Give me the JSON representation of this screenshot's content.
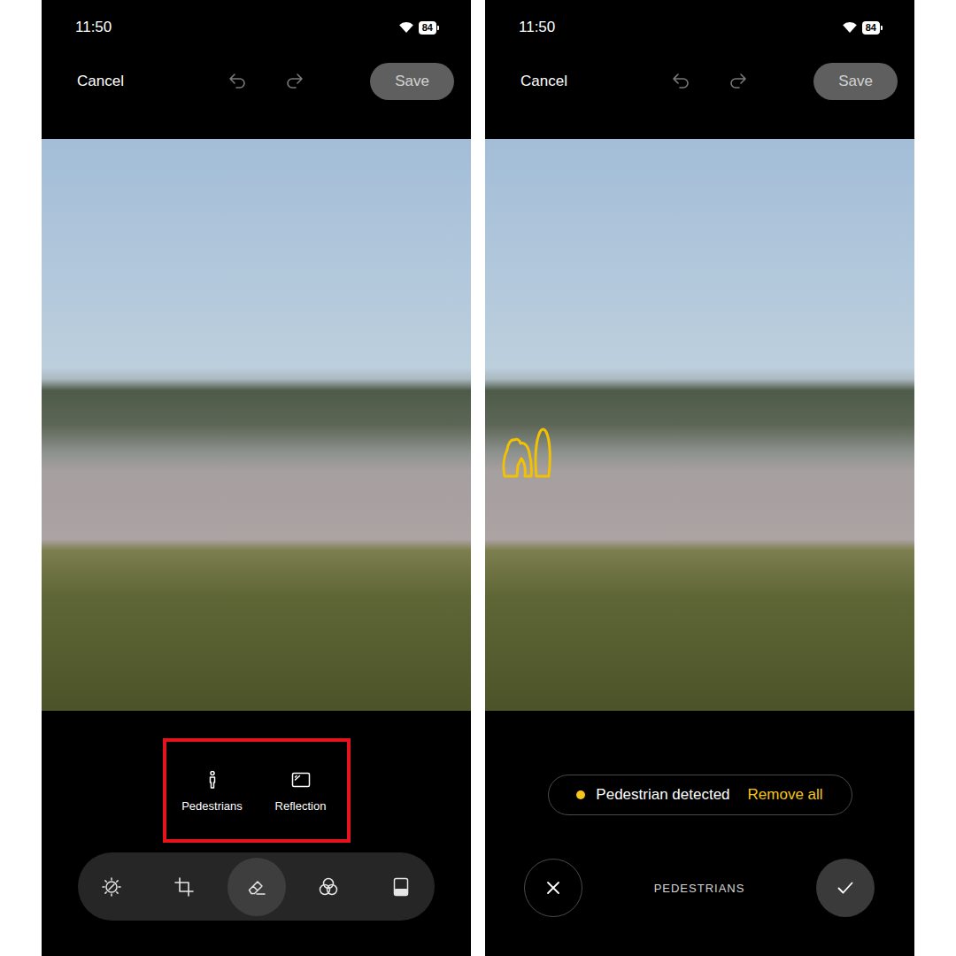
{
  "screens": [
    {
      "kind": "tools",
      "status_bar": {
        "time": "11:50",
        "battery": "84"
      },
      "top_bar": {
        "cancel": "Cancel",
        "undo_enabled": false,
        "redo_enabled": false,
        "save": {
          "label": "Save",
          "disabled": true
        }
      },
      "photo": {
        "highlights": []
      },
      "tool_options": {
        "outlined": true,
        "items": [
          {
            "kind": "pedestrian",
            "label": "Pedestrians"
          },
          {
            "kind": "reflection",
            "label": "Reflection"
          }
        ]
      },
      "toolbar": [
        {
          "kind": "adjust",
          "selected": false
        },
        {
          "kind": "crop",
          "selected": false
        },
        {
          "kind": "erase",
          "selected": true
        },
        {
          "kind": "filters",
          "selected": false
        },
        {
          "kind": "frame",
          "selected": false
        }
      ]
    },
    {
      "kind": "detection",
      "status_bar": {
        "time": "11:50",
        "battery": "84"
      },
      "top_bar": {
        "cancel": "Cancel",
        "undo_enabled": false,
        "redo_enabled": false,
        "save": {
          "label": "Save",
          "disabled": true
        }
      },
      "photo": {
        "highlights": [
          {
            "kind": "pair"
          },
          {
            "kind": "single"
          }
        ]
      },
      "detection": {
        "status": "Pedestrian detected",
        "action": "Remove all",
        "mode": "PEDESTRIANS"
      }
    }
  ]
}
